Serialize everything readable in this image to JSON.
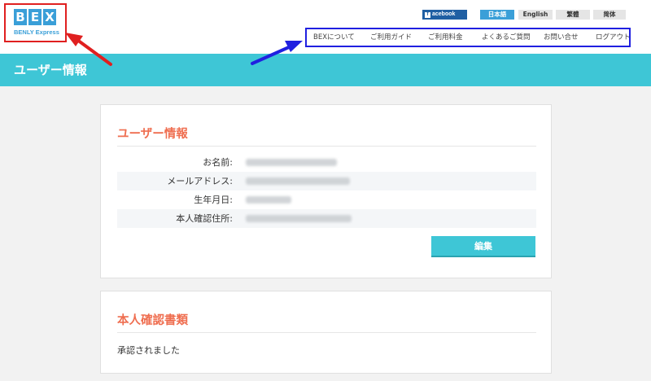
{
  "logo": {
    "letters": [
      "B",
      "E",
      "X"
    ],
    "subtitle": "BENLY Express"
  },
  "header": {
    "facebook_label": "acebook",
    "languages": [
      "日本語",
      "English",
      "繁體",
      "简体"
    ],
    "active_language": "日本語"
  },
  "nav": {
    "items": [
      "BEXについて",
      "ご利用ガイド",
      "ご利用料金",
      "よくあるご質問",
      "お問い合せ",
      "ログアウト"
    ]
  },
  "banner": {
    "title": "ユーザー情報"
  },
  "user_info": {
    "title": "ユーザー情報",
    "fields": [
      {
        "label": "お名前:"
      },
      {
        "label": "メールアドレス:"
      },
      {
        "label": "生年月日:"
      },
      {
        "label": "本人確認住所:"
      }
    ],
    "edit_label": "編集"
  },
  "identity_docs": {
    "title": "本人確認書類",
    "status": "承認されました"
  },
  "colors": {
    "accent": "#3ec6d6",
    "title": "#ef6e50",
    "brand": "#3a9fd8",
    "annotation_red": "#e02020",
    "annotation_blue": "#2020e0"
  }
}
